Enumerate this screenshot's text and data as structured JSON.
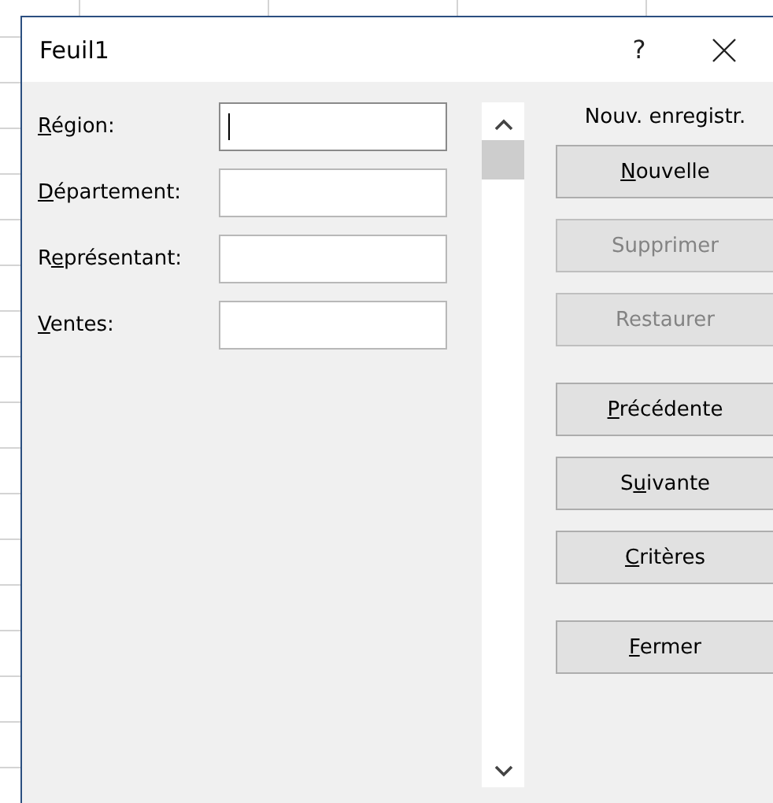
{
  "window": {
    "title": "Feuil1",
    "help": "?"
  },
  "fields": [
    {
      "key": "R",
      "after": "égion:",
      "focused": true
    },
    {
      "key": "D",
      "after": "épartement:",
      "focused": false
    },
    {
      "before": "R",
      "key": "e",
      "after": "présentant:",
      "focused": false
    },
    {
      "key": "V",
      "after": "entes:",
      "focused": false
    }
  ],
  "record_status": "Nouv. enregistr.",
  "button_groups": [
    {
      "buttons": [
        {
          "key": "N",
          "after": "ouvelle",
          "disabled": false
        },
        {
          "before": "Supprimer",
          "disabled": true
        },
        {
          "before": "Restaurer",
          "disabled": true
        }
      ]
    },
    {
      "buttons": [
        {
          "key": "P",
          "after": "récédente",
          "disabled": false
        },
        {
          "before": "S",
          "key": "u",
          "after": "ivante",
          "disabled": false
        },
        {
          "key": "C",
          "after": "ritères",
          "disabled": false
        }
      ]
    },
    {
      "buttons": [
        {
          "key": "F",
          "after": "ermer",
          "disabled": false
        }
      ]
    }
  ]
}
